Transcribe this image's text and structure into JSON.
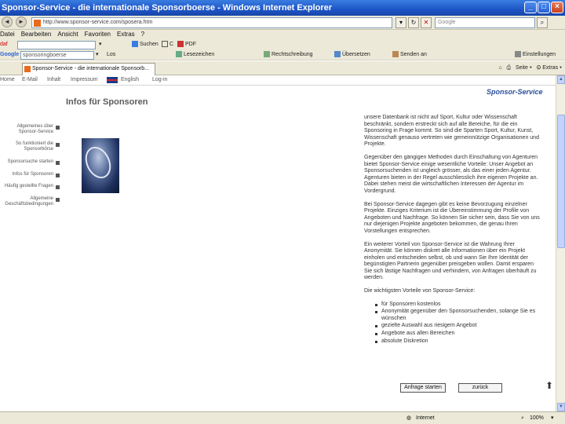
{
  "window": {
    "title": "Sponsor-Service - die internationale Sponsorboerse - Windows Internet Explorer"
  },
  "addressbar": {
    "url": "http://www.sponsor-service.com/sposera.htm",
    "search_placeholder": "Google"
  },
  "menu": {
    "items": [
      "Datei",
      "Bearbeiten",
      "Ansicht",
      "Favoriten",
      "Extras",
      "?"
    ]
  },
  "toolbar1": {
    "label": "daf",
    "search_btn": "Suchen",
    "pdf_label": "PDF"
  },
  "toolbar2": {
    "google_label": "Google",
    "query": "sponsoringboerse",
    "go_label": "Los",
    "items": [
      "Lesezeichen",
      "Rechtschreibung",
      "Übersetzen",
      "Senden an",
      "Einstellungen"
    ]
  },
  "tab": {
    "label": "Sponsor-Service - die internationale Sponsorb..."
  },
  "tabtools": {
    "page": "Seite",
    "extras": "Extras"
  },
  "site": {
    "nav": [
      "Home",
      "E-Mail",
      "Inhalt",
      "Impressum",
      "English",
      "Log-in"
    ],
    "brand": "Sponsor-Service",
    "heading": "Infos für Sponsoren",
    "sidemenu": [
      "Allgemeines über Sponsor-Service",
      "So funktioniert die Sponsorbörse",
      "Sponsorsuche starten",
      "Infos für Sponsoren",
      "Häufig gestellte Fragen",
      "Allgemeine Geschäftsbedingungen"
    ],
    "paragraphs": [
      "unsere Datenbank ist nicht auf Sport, Kultur oder Wissenschaft beschränkt, sondern erstreckt sich auf alle Bereiche, für die ein Sponsoring in Frage kommt. So sind die Sparten Sport, Kultur, Kunst, Wissenschaft genauso vertreten wie gemeinnützige Organisationen und Projekte.",
      "Gegenüber den gängigen Methoden durch Einschaltung von Agenturen bietet Sponsor-Service einige wesentliche Vorteile: Unser Angebot an Sponsorsuchenden ist ungleich grösser, als das einer jeden Agentur. Agenturen bieten in der Regel ausschliesslich ihre eigenen Projekte an. Dabei stehen meist die wirtschaftlichen Interessen der Agentur im Vordergrund.",
      "Bei Sponsor-Service dagegen gibt es keine Bevorzugung einzelner Projekte. Einziges Kriterium ist die Übereinstimmung der Profile von Angeboten und Nachfrage. So können Sie sicher sein, dass Sie von uns nur diejenigen Projekte angeboten bekommen, die genau Ihren Vorstellungen entsprechen.",
      "Ein weiterer Vorteil von Sponsor-Service ist die Wahrung Ihrer Anonymität. Sie können diskret alle Informationen über ein Projekt einholen und entscheiden selbst, ob und wann Sie Ihre Identität der begünstigten Partnerin gegenüber preisgeben wollen. Damit ersparen Sie sich lästige Nachfragen und verhindern, von Anfragen überhäuft zu werden.",
      "Die wichtigsten Vorteile von Sponsor-Service:"
    ],
    "benefits": [
      "für Sponsoren kostenlos",
      "Anonymität gegenüber den Sponsorsuchenden, solange Sie es wünschen",
      "gezielte Auswahl aus riesigem Angebot",
      "Angebote aus allen Bereichen",
      "absolute Diskretion"
    ],
    "btn_request": "Anfrage starten",
    "btn_back": "zurück"
  },
  "statusbar": {
    "zone": "Internet",
    "zoom": "100%"
  }
}
